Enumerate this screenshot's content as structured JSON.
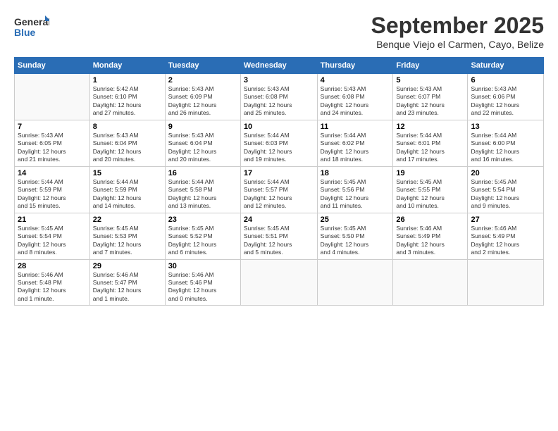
{
  "logo": {
    "line1": "General",
    "line2": "Blue"
  },
  "title": "September 2025",
  "subtitle": "Benque Viejo el Carmen, Cayo, Belize",
  "headers": [
    "Sunday",
    "Monday",
    "Tuesday",
    "Wednesday",
    "Thursday",
    "Friday",
    "Saturday"
  ],
  "weeks": [
    [
      {
        "num": "",
        "info": ""
      },
      {
        "num": "1",
        "info": "Sunrise: 5:42 AM\nSunset: 6:10 PM\nDaylight: 12 hours\nand 27 minutes."
      },
      {
        "num": "2",
        "info": "Sunrise: 5:43 AM\nSunset: 6:09 PM\nDaylight: 12 hours\nand 26 minutes."
      },
      {
        "num": "3",
        "info": "Sunrise: 5:43 AM\nSunset: 6:08 PM\nDaylight: 12 hours\nand 25 minutes."
      },
      {
        "num": "4",
        "info": "Sunrise: 5:43 AM\nSunset: 6:08 PM\nDaylight: 12 hours\nand 24 minutes."
      },
      {
        "num": "5",
        "info": "Sunrise: 5:43 AM\nSunset: 6:07 PM\nDaylight: 12 hours\nand 23 minutes."
      },
      {
        "num": "6",
        "info": "Sunrise: 5:43 AM\nSunset: 6:06 PM\nDaylight: 12 hours\nand 22 minutes."
      }
    ],
    [
      {
        "num": "7",
        "info": "Sunrise: 5:43 AM\nSunset: 6:05 PM\nDaylight: 12 hours\nand 21 minutes."
      },
      {
        "num": "8",
        "info": "Sunrise: 5:43 AM\nSunset: 6:04 PM\nDaylight: 12 hours\nand 20 minutes."
      },
      {
        "num": "9",
        "info": "Sunrise: 5:43 AM\nSunset: 6:04 PM\nDaylight: 12 hours\nand 20 minutes."
      },
      {
        "num": "10",
        "info": "Sunrise: 5:44 AM\nSunset: 6:03 PM\nDaylight: 12 hours\nand 19 minutes."
      },
      {
        "num": "11",
        "info": "Sunrise: 5:44 AM\nSunset: 6:02 PM\nDaylight: 12 hours\nand 18 minutes."
      },
      {
        "num": "12",
        "info": "Sunrise: 5:44 AM\nSunset: 6:01 PM\nDaylight: 12 hours\nand 17 minutes."
      },
      {
        "num": "13",
        "info": "Sunrise: 5:44 AM\nSunset: 6:00 PM\nDaylight: 12 hours\nand 16 minutes."
      }
    ],
    [
      {
        "num": "14",
        "info": "Sunrise: 5:44 AM\nSunset: 5:59 PM\nDaylight: 12 hours\nand 15 minutes."
      },
      {
        "num": "15",
        "info": "Sunrise: 5:44 AM\nSunset: 5:59 PM\nDaylight: 12 hours\nand 14 minutes."
      },
      {
        "num": "16",
        "info": "Sunrise: 5:44 AM\nSunset: 5:58 PM\nDaylight: 12 hours\nand 13 minutes."
      },
      {
        "num": "17",
        "info": "Sunrise: 5:44 AM\nSunset: 5:57 PM\nDaylight: 12 hours\nand 12 minutes."
      },
      {
        "num": "18",
        "info": "Sunrise: 5:45 AM\nSunset: 5:56 PM\nDaylight: 12 hours\nand 11 minutes."
      },
      {
        "num": "19",
        "info": "Sunrise: 5:45 AM\nSunset: 5:55 PM\nDaylight: 12 hours\nand 10 minutes."
      },
      {
        "num": "20",
        "info": "Sunrise: 5:45 AM\nSunset: 5:54 PM\nDaylight: 12 hours\nand 9 minutes."
      }
    ],
    [
      {
        "num": "21",
        "info": "Sunrise: 5:45 AM\nSunset: 5:54 PM\nDaylight: 12 hours\nand 8 minutes."
      },
      {
        "num": "22",
        "info": "Sunrise: 5:45 AM\nSunset: 5:53 PM\nDaylight: 12 hours\nand 7 minutes."
      },
      {
        "num": "23",
        "info": "Sunrise: 5:45 AM\nSunset: 5:52 PM\nDaylight: 12 hours\nand 6 minutes."
      },
      {
        "num": "24",
        "info": "Sunrise: 5:45 AM\nSunset: 5:51 PM\nDaylight: 12 hours\nand 5 minutes."
      },
      {
        "num": "25",
        "info": "Sunrise: 5:45 AM\nSunset: 5:50 PM\nDaylight: 12 hours\nand 4 minutes."
      },
      {
        "num": "26",
        "info": "Sunrise: 5:46 AM\nSunset: 5:49 PM\nDaylight: 12 hours\nand 3 minutes."
      },
      {
        "num": "27",
        "info": "Sunrise: 5:46 AM\nSunset: 5:49 PM\nDaylight: 12 hours\nand 2 minutes."
      }
    ],
    [
      {
        "num": "28",
        "info": "Sunrise: 5:46 AM\nSunset: 5:48 PM\nDaylight: 12 hours\nand 1 minute."
      },
      {
        "num": "29",
        "info": "Sunrise: 5:46 AM\nSunset: 5:47 PM\nDaylight: 12 hours\nand 1 minute."
      },
      {
        "num": "30",
        "info": "Sunrise: 5:46 AM\nSunset: 5:46 PM\nDaylight: 12 hours\nand 0 minutes."
      },
      {
        "num": "",
        "info": ""
      },
      {
        "num": "",
        "info": ""
      },
      {
        "num": "",
        "info": ""
      },
      {
        "num": "",
        "info": ""
      }
    ]
  ]
}
